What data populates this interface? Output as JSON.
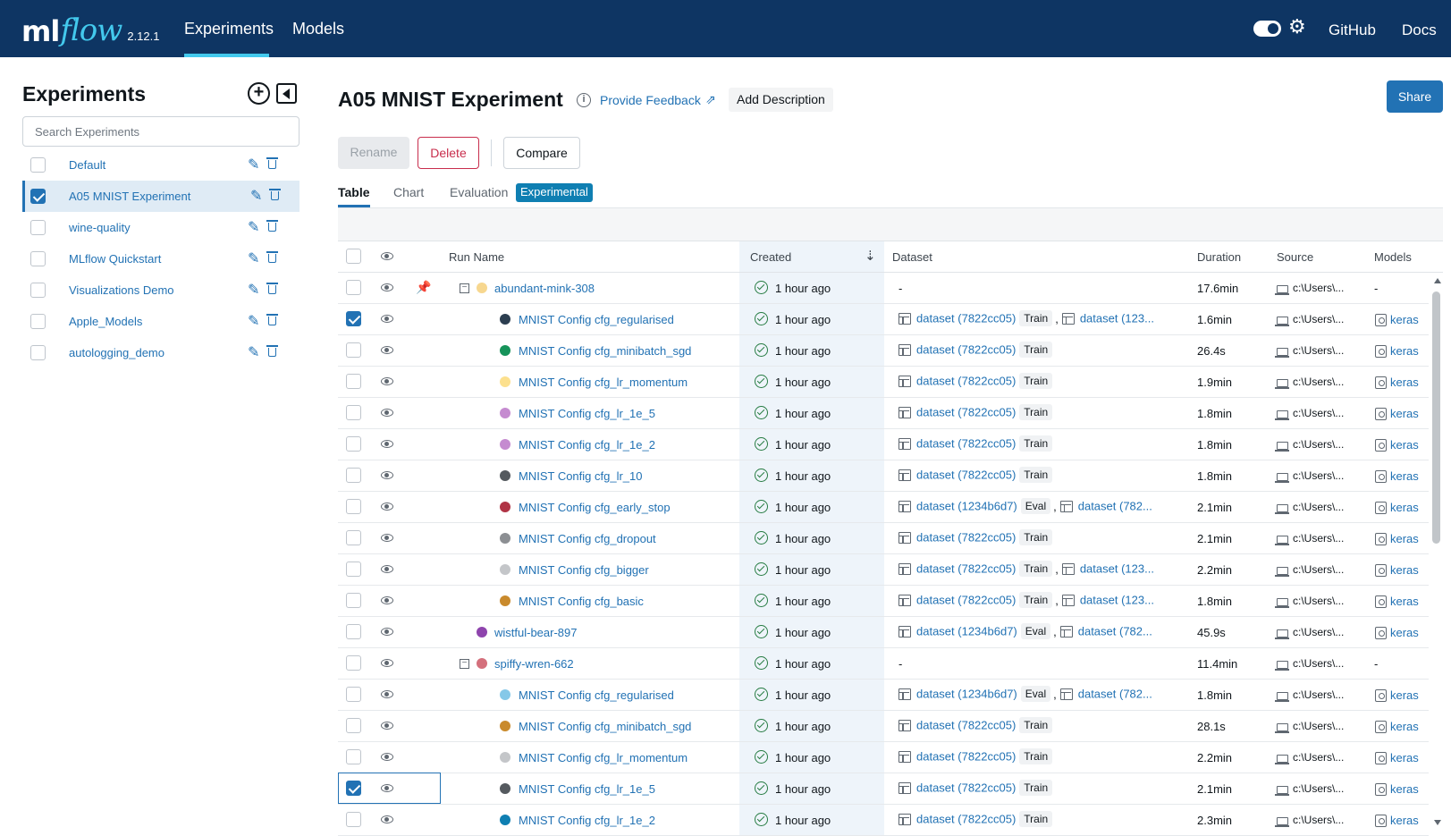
{
  "header": {
    "logo_ml": "ml",
    "logo_flow": "flow",
    "version": "2.12.1",
    "nav": [
      "Experiments",
      "Models"
    ],
    "github": "GitHub",
    "docs": "Docs"
  },
  "sidebar": {
    "title": "Experiments",
    "search_placeholder": "Search Experiments",
    "items": [
      {
        "label": "Default",
        "selected": false
      },
      {
        "label": "A05 MNIST Experiment",
        "selected": true
      },
      {
        "label": "wine-quality",
        "selected": false
      },
      {
        "label": "MLflow Quickstart",
        "selected": false
      },
      {
        "label": "Visualizations Demo",
        "selected": false
      },
      {
        "label": "Apple_Models",
        "selected": false
      },
      {
        "label": "autologging_demo",
        "selected": false
      }
    ]
  },
  "main": {
    "title": "A05 MNIST Experiment",
    "feedback": "Provide Feedback",
    "add_description": "Add Description",
    "share": "Share",
    "buttons": {
      "rename": "Rename",
      "delete": "Delete",
      "compare": "Compare"
    },
    "tabs": [
      "Table",
      "Chart",
      "Evaluation",
      "Experimental"
    ],
    "columns": {
      "run_name": "Run Name",
      "created": "Created",
      "dataset": "Dataset",
      "duration": "Duration",
      "source": "Source",
      "models": "Models"
    }
  },
  "runs": [
    {
      "name": "abundant-mink-308",
      "level": 0,
      "expander": true,
      "pin": true,
      "color": "#f7d78f",
      "checked": false,
      "created": "1 hour ago",
      "datasets": [],
      "duration": "17.6min",
      "source": "c:\\Users\\...",
      "model": "-"
    },
    {
      "name": "MNIST Config cfg_regularised",
      "level": 1,
      "color": "#2c3e50",
      "checked": true,
      "created": "1 hour ago",
      "datasets": [
        {
          "name": "dataset (7822cc05)",
          "tag": "Train"
        },
        {
          "name": "dataset (123...",
          "tag": ""
        }
      ],
      "duration": "1.6min",
      "source": "c:\\Users\\...",
      "model": "keras"
    },
    {
      "name": "MNIST Config cfg_minibatch_sgd",
      "level": 1,
      "color": "#16935a",
      "checked": false,
      "created": "1 hour ago",
      "datasets": [
        {
          "name": "dataset (7822cc05)",
          "tag": "Train"
        }
      ],
      "duration": "26.4s",
      "source": "c:\\Users\\...",
      "model": "keras"
    },
    {
      "name": "MNIST Config cfg_lr_momentum",
      "level": 1,
      "color": "#fce08e",
      "checked": false,
      "created": "1 hour ago",
      "datasets": [
        {
          "name": "dataset (7822cc05)",
          "tag": "Train"
        }
      ],
      "duration": "1.9min",
      "source": "c:\\Users\\...",
      "model": "keras"
    },
    {
      "name": "MNIST Config cfg_lr_1e_5",
      "level": 1,
      "color": "#c58bd0",
      "checked": false,
      "created": "1 hour ago",
      "datasets": [
        {
          "name": "dataset (7822cc05)",
          "tag": "Train"
        }
      ],
      "duration": "1.8min",
      "source": "c:\\Users\\...",
      "model": "keras"
    },
    {
      "name": "MNIST Config cfg_lr_1e_2",
      "level": 1,
      "color": "#c58bd0",
      "checked": false,
      "created": "1 hour ago",
      "datasets": [
        {
          "name": "dataset (7822cc05)",
          "tag": "Train"
        }
      ],
      "duration": "1.8min",
      "source": "c:\\Users\\...",
      "model": "keras"
    },
    {
      "name": "MNIST Config cfg_lr_10",
      "level": 1,
      "color": "#555a5f",
      "checked": false,
      "created": "1 hour ago",
      "datasets": [
        {
          "name": "dataset (7822cc05)",
          "tag": "Train"
        }
      ],
      "duration": "1.8min",
      "source": "c:\\Users\\...",
      "model": "keras"
    },
    {
      "name": "MNIST Config cfg_early_stop",
      "level": 1,
      "color": "#b03445",
      "checked": false,
      "created": "1 hour ago",
      "datasets": [
        {
          "name": "dataset (1234b6d7)",
          "tag": "Eval"
        },
        {
          "name": "dataset (782...",
          "tag": ""
        }
      ],
      "duration": "2.1min",
      "source": "c:\\Users\\...",
      "model": "keras"
    },
    {
      "name": "MNIST Config cfg_dropout",
      "level": 1,
      "color": "#8c8f93",
      "checked": false,
      "created": "1 hour ago",
      "datasets": [
        {
          "name": "dataset (7822cc05)",
          "tag": "Train"
        }
      ],
      "duration": "2.1min",
      "source": "c:\\Users\\...",
      "model": "keras"
    },
    {
      "name": "MNIST Config cfg_bigger",
      "level": 1,
      "color": "#c4c6c9",
      "checked": false,
      "created": "1 hour ago",
      "datasets": [
        {
          "name": "dataset (7822cc05)",
          "tag": "Train"
        },
        {
          "name": "dataset (123...",
          "tag": ""
        }
      ],
      "duration": "2.2min",
      "source": "c:\\Users\\...",
      "model": "keras"
    },
    {
      "name": "MNIST Config cfg_basic",
      "level": 1,
      "color": "#c98a2c",
      "checked": false,
      "created": "1 hour ago",
      "datasets": [
        {
          "name": "dataset (7822cc05)",
          "tag": "Train"
        },
        {
          "name": "dataset (123...",
          "tag": ""
        }
      ],
      "duration": "1.8min",
      "source": "c:\\Users\\...",
      "model": "keras"
    },
    {
      "name": "wistful-bear-897",
      "level": 0,
      "expander": false,
      "color": "#8e44ad",
      "checked": false,
      "created": "1 hour ago",
      "datasets": [
        {
          "name": "dataset (1234b6d7)",
          "tag": "Eval"
        },
        {
          "name": "dataset (782...",
          "tag": ""
        }
      ],
      "duration": "45.9s",
      "source": "c:\\Users\\...",
      "model": "keras"
    },
    {
      "name": "spiffy-wren-662",
      "level": 0,
      "expander": true,
      "color": "#d4707c",
      "checked": false,
      "created": "1 hour ago",
      "datasets": [],
      "duration": "11.4min",
      "source": "c:\\Users\\...",
      "model": "-"
    },
    {
      "name": "MNIST Config cfg_regularised",
      "level": 1,
      "color": "#85c8e8",
      "checked": false,
      "created": "1 hour ago",
      "datasets": [
        {
          "name": "dataset (1234b6d7)",
          "tag": "Eval"
        },
        {
          "name": "dataset (782...",
          "tag": ""
        }
      ],
      "duration": "1.8min",
      "source": "c:\\Users\\...",
      "model": "keras"
    },
    {
      "name": "MNIST Config cfg_minibatch_sgd",
      "level": 1,
      "color": "#c98a2c",
      "checked": false,
      "created": "1 hour ago",
      "datasets": [
        {
          "name": "dataset (7822cc05)",
          "tag": "Train"
        }
      ],
      "duration": "28.1s",
      "source": "c:\\Users\\...",
      "model": "keras"
    },
    {
      "name": "MNIST Config cfg_lr_momentum",
      "level": 1,
      "color": "#c4c6c9",
      "checked": false,
      "created": "1 hour ago",
      "datasets": [
        {
          "name": "dataset (7822cc05)",
          "tag": "Train"
        }
      ],
      "duration": "2.2min",
      "source": "c:\\Users\\...",
      "model": "keras"
    },
    {
      "name": "MNIST Config cfg_lr_1e_5",
      "level": 1,
      "color": "#555a5f",
      "checked": true,
      "created": "1 hour ago",
      "datasets": [
        {
          "name": "dataset (7822cc05)",
          "tag": "Train"
        }
      ],
      "duration": "2.1min",
      "source": "c:\\Users\\...",
      "model": "keras"
    },
    {
      "name": "MNIST Config cfg_lr_1e_2",
      "level": 1,
      "color": "#0f7fb2",
      "checked": false,
      "created": "1 hour ago",
      "datasets": [
        {
          "name": "dataset (7822cc05)",
          "tag": "Train"
        }
      ],
      "duration": "2.3min",
      "source": "c:\\Users\\...",
      "model": "keras"
    }
  ]
}
